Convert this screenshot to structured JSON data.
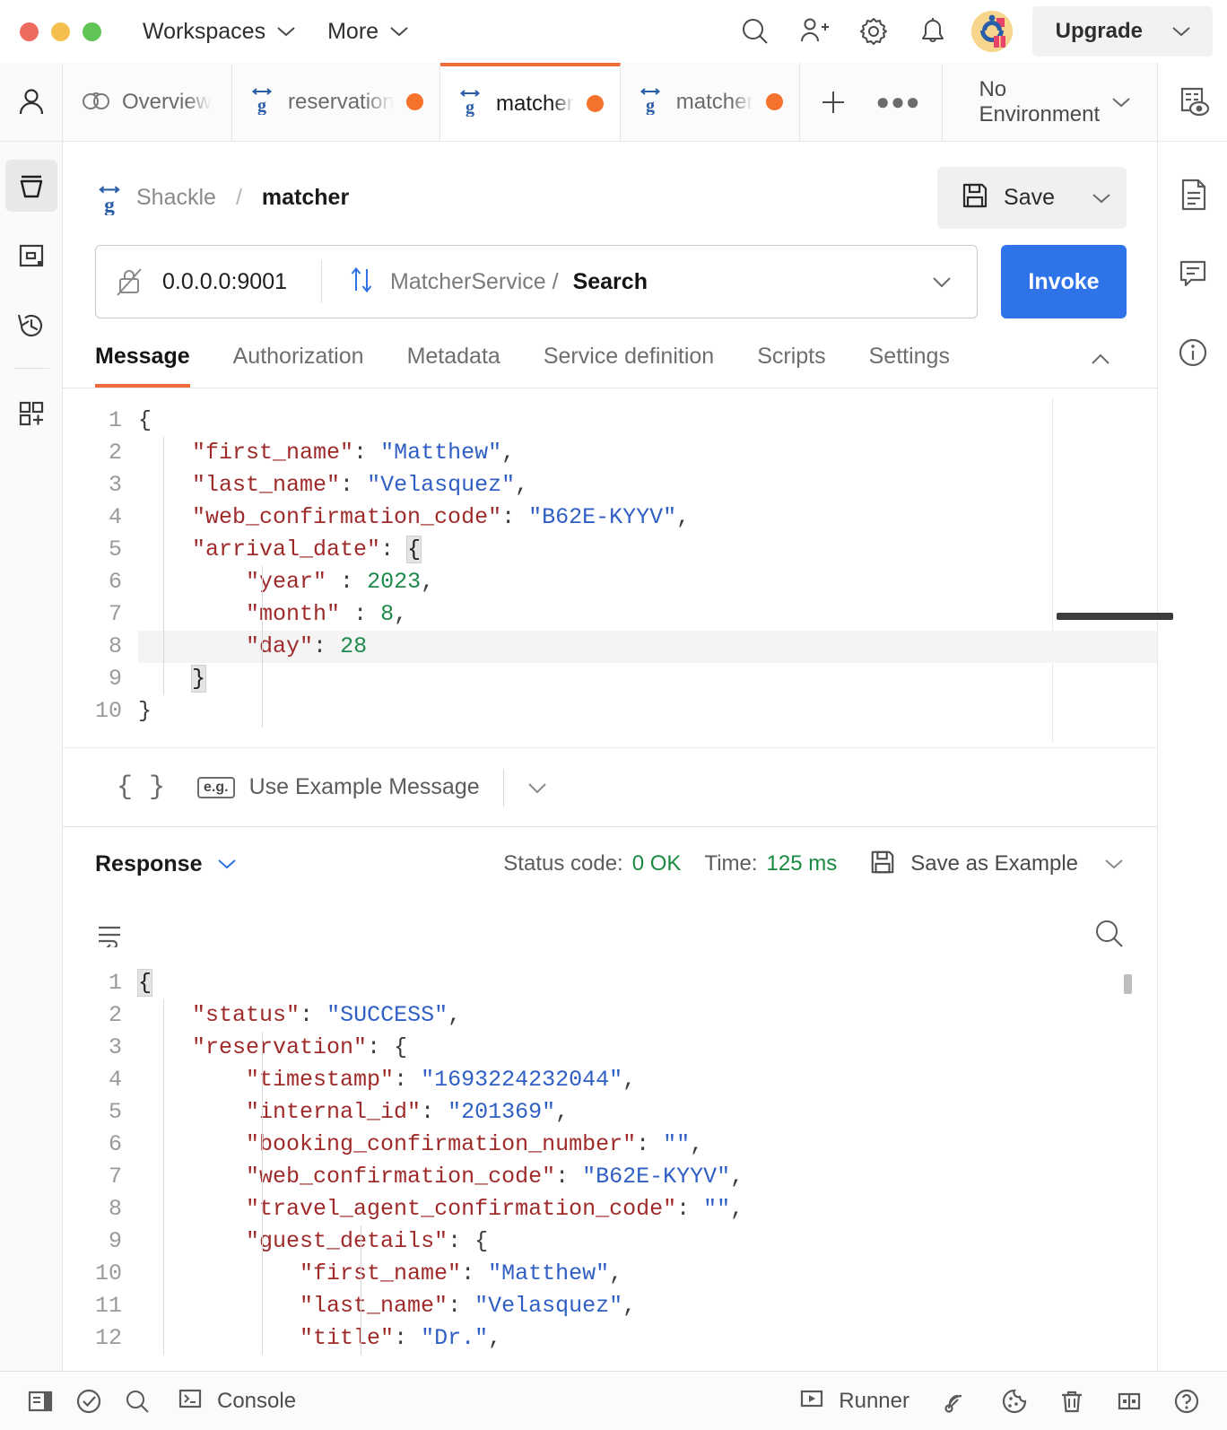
{
  "titlebar": {
    "menus": [
      {
        "label": "Workspaces",
        "icon": "chevron-down-icon"
      },
      {
        "label": "More",
        "icon": "chevron-down-icon"
      }
    ],
    "icons": [
      "search-icon",
      "invite-user-icon",
      "gear-icon",
      "bell-icon"
    ],
    "avatar": "user-avatar",
    "upgrade_label": "Upgrade"
  },
  "leftrail": {
    "items": [
      "person-icon",
      "collections-icon",
      "apis-icon",
      "history-icon",
      "new-icon"
    ]
  },
  "rightrail": {
    "items": [
      "environment-quick-look-icon",
      "documentation-icon",
      "comments-icon",
      "info-icon"
    ]
  },
  "tabs": [
    {
      "label": "Overview",
      "icon": "overview-icon",
      "dirty": false,
      "active": false
    },
    {
      "label": "reservation",
      "icon": "grpc-icon",
      "dirty": true,
      "active": false
    },
    {
      "label": "matcher",
      "icon": "grpc-icon",
      "dirty": true,
      "active": true
    },
    {
      "label": "matcher",
      "icon": "grpc-icon",
      "dirty": true,
      "active": false
    }
  ],
  "tabstrip": {
    "add_label": "+",
    "more_label": "●●●",
    "environment": "No Environment"
  },
  "request": {
    "breadcrumb_workspace": "Shackle",
    "breadcrumb_separator": "/",
    "breadcrumb_name": "matcher",
    "save_label": "Save",
    "url": "0.0.0.0:9001",
    "service": "MatcherService /",
    "method": "Search",
    "invoke_label": "Invoke",
    "tabs": [
      {
        "label": "Message",
        "active": true
      },
      {
        "label": "Authorization",
        "active": false
      },
      {
        "label": "Metadata",
        "active": false
      },
      {
        "label": "Service definition",
        "active": false
      },
      {
        "label": "Scripts",
        "active": false
      },
      {
        "label": "Settings",
        "active": false
      }
    ]
  },
  "message_editor": {
    "line_numbers": [
      "1",
      "2",
      "3",
      "4",
      "5",
      "6",
      "7",
      "8",
      "9",
      "10"
    ],
    "highlighted_line": 8,
    "lines": [
      [
        {
          "t": "{",
          "c": "p"
        }
      ],
      [
        {
          "t": "    ",
          "c": "p"
        },
        {
          "t": "\"first_name\"",
          "c": "k"
        },
        {
          "t": ": ",
          "c": "p"
        },
        {
          "t": "\"Matthew\"",
          "c": "s"
        },
        {
          "t": ",",
          "c": "p"
        }
      ],
      [
        {
          "t": "    ",
          "c": "p"
        },
        {
          "t": "\"last_name\"",
          "c": "k"
        },
        {
          "t": ": ",
          "c": "p"
        },
        {
          "t": "\"Velasquez\"",
          "c": "s"
        },
        {
          "t": ",",
          "c": "p"
        }
      ],
      [
        {
          "t": "    ",
          "c": "p"
        },
        {
          "t": "\"web_confirmation_code\"",
          "c": "k"
        },
        {
          "t": ": ",
          "c": "p"
        },
        {
          "t": "\"B62E-KYYV\"",
          "c": "s"
        },
        {
          "t": ",",
          "c": "p"
        }
      ],
      [
        {
          "t": "    ",
          "c": "p"
        },
        {
          "t": "\"arrival_date\"",
          "c": "k"
        },
        {
          "t": ": ",
          "c": "p"
        },
        {
          "t": "{",
          "c": "brace-hl"
        }
      ],
      [
        {
          "t": "        ",
          "c": "p"
        },
        {
          "t": "\"year\"",
          "c": "k"
        },
        {
          "t": " : ",
          "c": "p"
        },
        {
          "t": "2023",
          "c": "n"
        },
        {
          "t": ",",
          "c": "p"
        }
      ],
      [
        {
          "t": "        ",
          "c": "p"
        },
        {
          "t": "\"month\"",
          "c": "k"
        },
        {
          "t": " : ",
          "c": "p"
        },
        {
          "t": "8",
          "c": "n"
        },
        {
          "t": ",",
          "c": "p"
        }
      ],
      [
        {
          "t": "        ",
          "c": "p"
        },
        {
          "t": "\"day\"",
          "c": "k"
        },
        {
          "t": ": ",
          "c": "p"
        },
        {
          "t": "28",
          "c": "n"
        }
      ],
      [
        {
          "t": "    ",
          "c": "p"
        },
        {
          "t": "}",
          "c": "brace-hl"
        }
      ],
      [
        {
          "t": "}",
          "c": "p"
        }
      ]
    ]
  },
  "example_bar": {
    "braces": "{ }",
    "badge": "e.g.",
    "label": "Use Example Message"
  },
  "response": {
    "title": "Response",
    "status_label": "Status code:",
    "status_value": "0 OK",
    "time_label": "Time:",
    "time_value": "125 ms",
    "save_example_label": "Save as Example",
    "wrap_icon": "word-wrap-icon",
    "search_icon": "search-icon",
    "line_numbers": [
      "1",
      "2",
      "3",
      "4",
      "5",
      "6",
      "7",
      "8",
      "9",
      "10",
      "11",
      "12"
    ],
    "lines": [
      [
        {
          "t": "{",
          "c": "brace-hl"
        }
      ],
      [
        {
          "t": "    ",
          "c": "p"
        },
        {
          "t": "\"status\"",
          "c": "k"
        },
        {
          "t": ": ",
          "c": "p"
        },
        {
          "t": "\"SUCCESS\"",
          "c": "s"
        },
        {
          "t": ",",
          "c": "p"
        }
      ],
      [
        {
          "t": "    ",
          "c": "p"
        },
        {
          "t": "\"reservation\"",
          "c": "k"
        },
        {
          "t": ": ",
          "c": "p"
        },
        {
          "t": "{",
          "c": "p"
        }
      ],
      [
        {
          "t": "        ",
          "c": "p"
        },
        {
          "t": "\"timestamp\"",
          "c": "k"
        },
        {
          "t": ": ",
          "c": "p"
        },
        {
          "t": "\"1693224232044\"",
          "c": "s"
        },
        {
          "t": ",",
          "c": "p"
        }
      ],
      [
        {
          "t": "        ",
          "c": "p"
        },
        {
          "t": "\"internal_id\"",
          "c": "k"
        },
        {
          "t": ": ",
          "c": "p"
        },
        {
          "t": "\"201369\"",
          "c": "s"
        },
        {
          "t": ",",
          "c": "p"
        }
      ],
      [
        {
          "t": "        ",
          "c": "p"
        },
        {
          "t": "\"booking_confirmation_number\"",
          "c": "k"
        },
        {
          "t": ": ",
          "c": "p"
        },
        {
          "t": "\"\"",
          "c": "s"
        },
        {
          "t": ",",
          "c": "p"
        }
      ],
      [
        {
          "t": "        ",
          "c": "p"
        },
        {
          "t": "\"web_confirmation_code\"",
          "c": "k"
        },
        {
          "t": ": ",
          "c": "p"
        },
        {
          "t": "\"B62E-KYYV\"",
          "c": "s"
        },
        {
          "t": ",",
          "c": "p"
        }
      ],
      [
        {
          "t": "        ",
          "c": "p"
        },
        {
          "t": "\"travel_agent_confirmation_code\"",
          "c": "k"
        },
        {
          "t": ": ",
          "c": "p"
        },
        {
          "t": "\"\"",
          "c": "s"
        },
        {
          "t": ",",
          "c": "p"
        }
      ],
      [
        {
          "t": "        ",
          "c": "p"
        },
        {
          "t": "\"guest_details\"",
          "c": "k"
        },
        {
          "t": ": ",
          "c": "p"
        },
        {
          "t": "{",
          "c": "p"
        }
      ],
      [
        {
          "t": "            ",
          "c": "p"
        },
        {
          "t": "\"first_name\"",
          "c": "k"
        },
        {
          "t": ": ",
          "c": "p"
        },
        {
          "t": "\"Matthew\"",
          "c": "s"
        },
        {
          "t": ",",
          "c": "p"
        }
      ],
      [
        {
          "t": "            ",
          "c": "p"
        },
        {
          "t": "\"last_name\"",
          "c": "k"
        },
        {
          "t": ": ",
          "c": "p"
        },
        {
          "t": "\"Velasquez\"",
          "c": "s"
        },
        {
          "t": ",",
          "c": "p"
        }
      ],
      [
        {
          "t": "            ",
          "c": "p"
        },
        {
          "t": "\"title\"",
          "c": "k"
        },
        {
          "t": ": ",
          "c": "p"
        },
        {
          "t": "\"Dr.\"",
          "c": "s"
        },
        {
          "t": ",",
          "c": "p"
        }
      ]
    ]
  },
  "statusbar": {
    "sidebar_icon": "toggle-sidebar-icon",
    "check_icon": "check-circle-icon",
    "search_icon": "search-icon",
    "console_label": "Console",
    "runner_label": "Runner",
    "right_icons": [
      "capture-requests-icon",
      "cookies-icon",
      "trash-icon",
      "layout-icon",
      "help-icon"
    ]
  },
  "colors": {
    "accent_orange": "#f26b3a",
    "invoke_blue": "#2f73e8",
    "success_green": "#1a8a42",
    "key_red": "#9e2a2a",
    "string_blue": "#2f5fc4"
  }
}
